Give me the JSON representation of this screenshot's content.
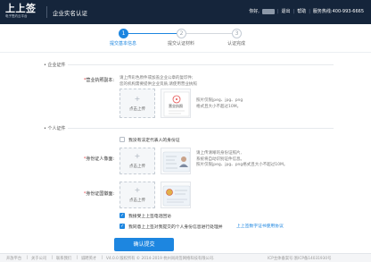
{
  "header": {
    "logo_text": "上上签",
    "logo_sub": "电子签约云平台",
    "page_title": "企业实名认证",
    "greeting": "你好,",
    "link_account": "退出",
    "link_help": "帮助",
    "service_hotline": "服务热线:400-993-6665"
  },
  "steps": [
    {
      "num": "1",
      "label": "提交基本信息",
      "active": true
    },
    {
      "num": "2",
      "label": "提交认证材料",
      "active": false
    },
    {
      "num": "3",
      "label": "认证完成",
      "active": false
    }
  ],
  "enterprise_section": {
    "title": "企业证件",
    "license_label": "营业执照副本:",
    "license_hint_lines": [
      "请上传彩色原件或加盖企业公章的复印件;",
      "您的机构需要提供企业资质,请使用营业执照"
    ],
    "upload_label": "点击上传",
    "sample_stamp_text": "营业执照",
    "format_hint_lines": [
      "照片仅限jpeg、jpg、png",
      "格式且大小不超过10M。"
    ]
  },
  "personal_section": {
    "title": "个人证件",
    "no_id_checkbox_label": "我没有法定代表人的身份证",
    "id_front_label": "身份证人像面:",
    "id_back_label": "身份证国徽面:",
    "upload_label": "点击上传",
    "id_hint_lines": [
      "请上传清晰的身份证照片,",
      "系统将自动识别证件信息。",
      "照片仅限jpeg、jpg、png格式且大小不超过10M。"
    ]
  },
  "agreements": {
    "check1": "我接受上上签电话回访",
    "check2_prefix": "我同意上上签对我提交的个人身份信息进行处理并",
    "check2_link": "上上签数字证书使用协议"
  },
  "submit_label": "确认提交",
  "footer": {
    "links": [
      "开放平台",
      "关于公司",
      "联系我们",
      "诚聘英才"
    ],
    "version": "V4.0.0 版权所有 © 2014-2019 杭州尚尚签网络科技有限公司.",
    "icp": "ICP主体备案号:浙ICP备14031930号"
  }
}
